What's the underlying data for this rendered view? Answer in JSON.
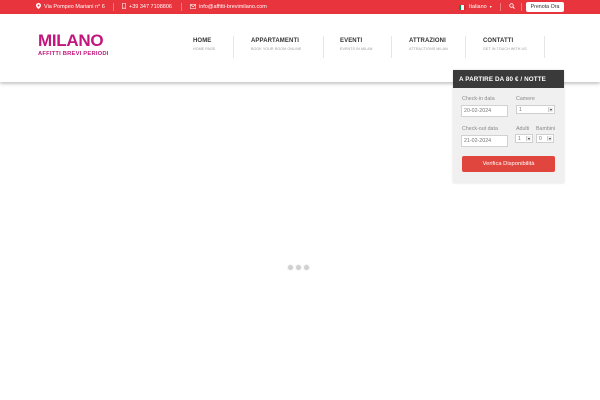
{
  "topbar": {
    "address": "Via Pompeo Mariani n° 6",
    "phone": "+39 347 7108806",
    "email": "info@affitti-brevimilano.com",
    "language": "Italiano",
    "book_now_label": "Prenota Ora",
    "background_color": "#e8343c"
  },
  "logo": {
    "title": "MILANO",
    "subtitle": "AFFITTI BREVI PERIODI",
    "color": "#c2167d"
  },
  "nav": {
    "items": [
      {
        "title": "HOME",
        "sub": "HOME PAGE"
      },
      {
        "title": "APPARTAMENTI",
        "sub": "BOOK YOUR ROOM ONLINE"
      },
      {
        "title": "EVENTI",
        "sub": "EVENTS IN MILAN"
      },
      {
        "title": "ATTRAZIONI",
        "sub": "ATTRACTIONS MILAN"
      },
      {
        "title": "CONTATTI",
        "sub": "GET IN TOUCH WITH US"
      }
    ]
  },
  "booking": {
    "header": "A PARTIRE DA 80 € / NOTTE",
    "checkin_label": "Check-in data",
    "checkin_value": "20-02-2024",
    "rooms_label": "Camere",
    "rooms_value": "1",
    "checkout_label": "Check-out data",
    "checkout_value": "21-02-2024",
    "adults_label": "Adulti",
    "adults_value": "1",
    "children_label": "Bambini",
    "children_value": "0",
    "verify_label": "Verifica Disponibilità",
    "button_color": "#e0453e"
  }
}
